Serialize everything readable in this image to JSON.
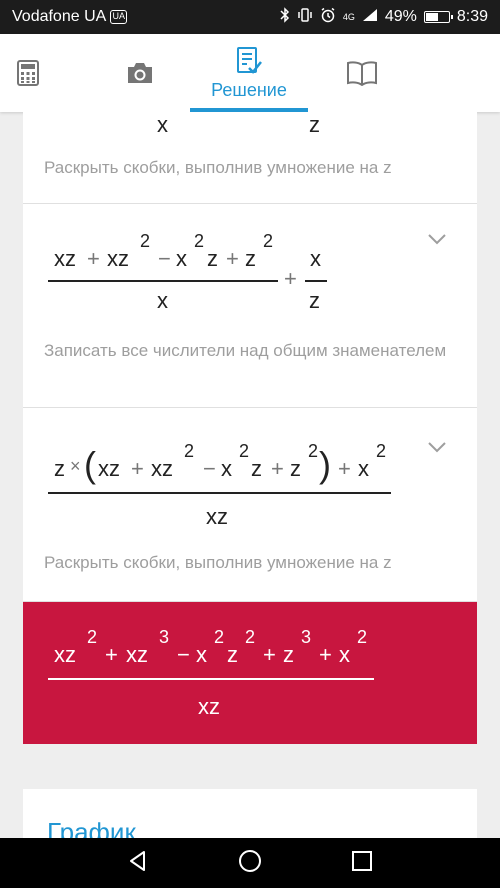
{
  "status_bar": {
    "carrier": "Vodafone UA",
    "sim_badge": "UA",
    "network": "4G",
    "battery_text": "49%",
    "battery_level": 0.49,
    "time": "8:39"
  },
  "app_bar": {
    "tabs": [
      {
        "icon": "calculator-icon",
        "label": ""
      },
      {
        "icon": "camera-icon",
        "label": ""
      },
      {
        "icon": "solution-icon",
        "label": "Решение",
        "active": true
      },
      {
        "icon": "book-icon",
        "label": ""
      }
    ],
    "accent_color": "#2196d3"
  },
  "steps": [
    {
      "partial_top": {
        "den_left": "x",
        "den_right": "z"
      },
      "description_prefix": "Раскрыть скобки, выполнив умножение на",
      "description_var": "z"
    },
    {
      "numerator": {
        "t1": "xz",
        "op1": "+",
        "t2": "xz",
        "e2": "2",
        "op2": "−",
        "t3a": "x",
        "e3a": "2",
        "t3b": "z",
        "op3": "+",
        "t4": "z",
        "e4": "2"
      },
      "denominator": "x",
      "plus": "+",
      "second_fraction": {
        "numerator": "x",
        "denominator": "z"
      },
      "description": "Записать все числители над общим знаменателем"
    },
    {
      "numerator": {
        "lead": "z",
        "times": "×",
        "lparen": "(",
        "t1": "xz",
        "op1": "+",
        "t2": "xz",
        "e2": "2",
        "op2": "−",
        "t3a": "x",
        "e3a": "2",
        "t3b": "z",
        "op3": "+",
        "t4": "z",
        "e4": "2",
        "rparen": ")",
        "op4": "+",
        "t5": "x",
        "e5": "2"
      },
      "denominator": "xz",
      "description_prefix": "Раскрыть скобки, выполнив умножение на",
      "description_var": "z"
    }
  ],
  "result": {
    "numerator": {
      "t1": "xz",
      "e1": "2",
      "op1": "+",
      "t2": "xz",
      "e2": "3",
      "op2": "−",
      "t3a": "x",
      "e3a": "2",
      "t3b": "z",
      "e3b": "2",
      "op3": "+",
      "t4": "z",
      "e4": "3",
      "op4": "+",
      "t5": "x",
      "e5": "2"
    },
    "denominator": "xz",
    "color": "#c8163f"
  },
  "graph_card": {
    "title": "График"
  },
  "nav_bar": {
    "buttons": [
      "back-icon",
      "home-icon",
      "recents-icon"
    ]
  }
}
